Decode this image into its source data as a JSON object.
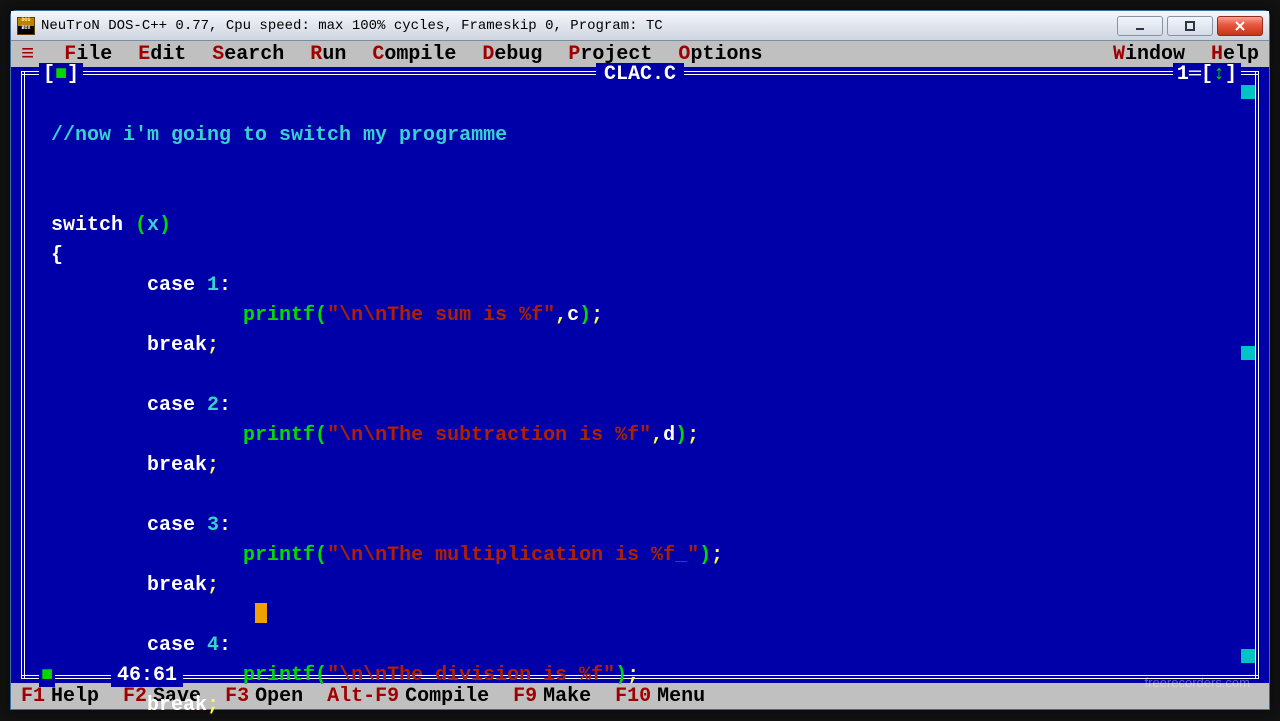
{
  "windowTitle": "NeuTroN DOS-C++ 0.77, Cpu speed: max 100% cycles, Frameskip  0, Program:     TC",
  "menu": {
    "file": "File",
    "edit": "Edit",
    "search": "Search",
    "run": "Run",
    "compile": "Compile",
    "debug": "Debug",
    "project": "Project",
    "options": "Options",
    "window": "Window",
    "help": "Help"
  },
  "frame": {
    "filename": "CLAC.C",
    "cornerTL_l": "[",
    "cornerTL_sq": "■",
    "cornerTL_r": "]",
    "cornerTR_num": "1",
    "cornerTR_eq": "═",
    "cornerTR_l": "[",
    "cornerTR_arr": "↕",
    "cornerTR_r": "]",
    "cornerBL": "■",
    "position": "46:61"
  },
  "code": {
    "c1": "//now i'm going to switch my programme",
    "kw_switch": "switch ",
    "lpar": "(",
    "var_x": "x",
    "rpar": ")",
    "lbrace": "{",
    "case": "case ",
    "n1": "1",
    "n2": "2",
    "n3": "3",
    "n4": "4",
    "colon": ":",
    "pr": "printf",
    "po": "(",
    "pc": ")",
    "semi": ";",
    "comma": ",",
    "s1": "\"\\n\\nThe sum is %f\"",
    "a1": "c",
    "s2": "\"\\n\\nThe subtraction is %f\"",
    "a2": "d",
    "s3": "\"\\n\\nThe multiplication is %f_\"",
    "s4": "\"\\n\\nThe division is %f\"",
    "brk": "break"
  },
  "shortcuts": {
    "f1": "F1",
    "f1t": "Help",
    "f2": "F2",
    "f2t": "Save",
    "f3": "F3",
    "f3t": "Open",
    "af9": "Alt-F9",
    "af9t": "Compile",
    "f9": "F9",
    "f9t": "Make",
    "f10": "F10",
    "f10t": "Menu"
  },
  "watermark": "freerecorders.com"
}
